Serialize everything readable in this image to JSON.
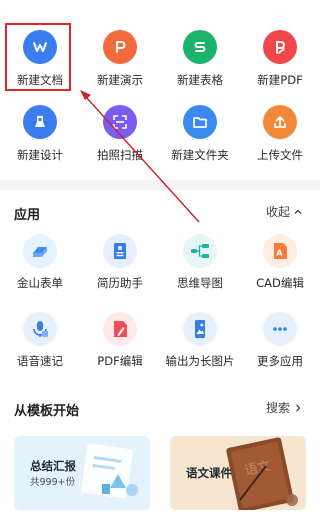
{
  "create_grid": [
    {
      "label": "新建文档",
      "icon": "wps-writer-icon",
      "color": "#3b7cf0"
    },
    {
      "label": "新建演示",
      "icon": "wps-presentation-icon",
      "color": "#f26a3d"
    },
    {
      "label": "新建表格",
      "icon": "wps-spreadsheet-icon",
      "color": "#1bb26b"
    },
    {
      "label": "新建PDF",
      "icon": "wps-pdf-icon",
      "color": "#f0474b"
    },
    {
      "label": "新建设计",
      "icon": "design-brush-icon",
      "color": "#3b7cf0"
    },
    {
      "label": "拍照扫描",
      "icon": "scan-icon",
      "color": "#7a5cf0"
    },
    {
      "label": "新建文件夹",
      "icon": "folder-icon",
      "color": "#3b88f0"
    },
    {
      "label": "上传文件",
      "icon": "upload-icon",
      "color": "#f2893a"
    }
  ],
  "apps_section": {
    "title": "应用",
    "action": "收起",
    "items": [
      {
        "label": "金山表单",
        "icon": "form-icon"
      },
      {
        "label": "简历助手",
        "icon": "resume-icon"
      },
      {
        "label": "思维导图",
        "icon": "mindmap-icon"
      },
      {
        "label": "CAD编辑",
        "icon": "cad-icon"
      },
      {
        "label": "语音速记",
        "icon": "voice-note-icon"
      },
      {
        "label": "PDF编辑",
        "icon": "pdf-edit-icon"
      },
      {
        "label": "输出为长图片",
        "icon": "long-image-icon"
      },
      {
        "label": "更多应用",
        "icon": "more-apps-icon"
      }
    ]
  },
  "templates_section": {
    "title": "从模板开始",
    "action": "搜索",
    "cards": [
      {
        "title": "总结汇报",
        "subtitle": "共999+份",
        "bg": "#e3f2fb"
      },
      {
        "title": "语文课件",
        "bg": "#f7e6cf"
      }
    ]
  },
  "accent_colors": {
    "highlight": "#e0262a",
    "arrow": "#c8242b"
  }
}
